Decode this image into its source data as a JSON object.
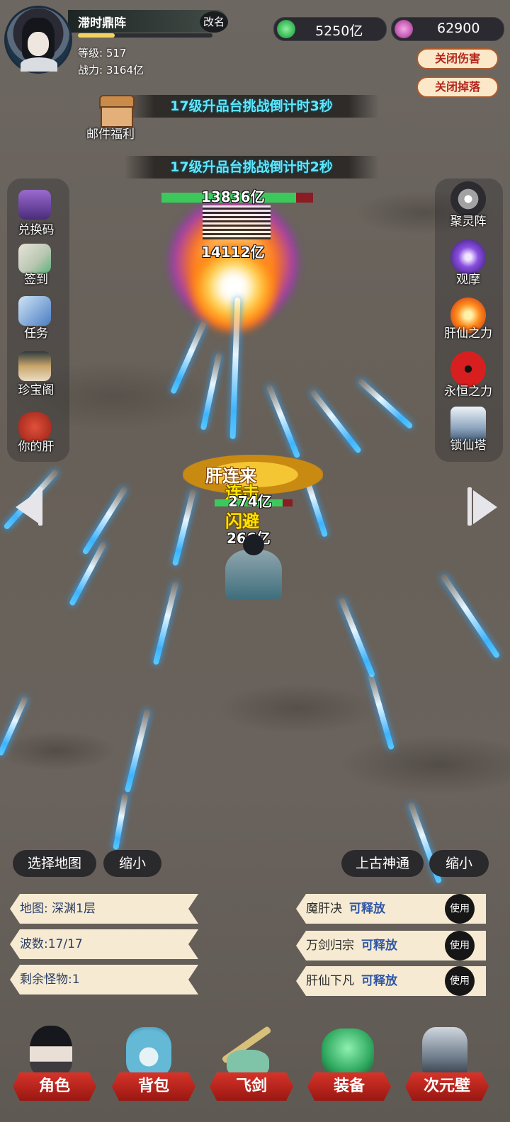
{
  "player": {
    "name": "滞时鼎阵",
    "rename_label": "改名",
    "level_text": "等级: 517",
    "power_text": "战力: 3164亿"
  },
  "currency": [
    {
      "icon": "green-gem-icon",
      "value": "5250亿",
      "color": "#3dbb5a"
    },
    {
      "icon": "pink-orb-icon",
      "value": "62900",
      "color": "#c45bb3"
    }
  ],
  "toggles": {
    "damage_label": "关闭伤害",
    "drop_label": "关闭掉落"
  },
  "banners": [
    "17级升品台挑战倒计时3秒",
    "17级升品台挑战倒计时2秒"
  ],
  "mail": {
    "label": "邮件福利"
  },
  "left_menu": [
    {
      "label": "兑换码",
      "icon": "treasure-chest-icon"
    },
    {
      "label": "签到",
      "icon": "scroll-icon"
    },
    {
      "label": "任务",
      "icon": "task-scroll-icon"
    },
    {
      "label": "珍宝阁",
      "icon": "pavilion-icon"
    },
    {
      "label": "你的肝",
      "icon": "liver-icon"
    }
  ],
  "right_menu": [
    {
      "label": "聚灵阵",
      "icon": "spirit-array-icon"
    },
    {
      "label": "观摩",
      "icon": "purple-orb-icon"
    },
    {
      "label": "肝仙之力",
      "icon": "fire-orb-icon"
    },
    {
      "label": "永恒之力",
      "icon": "red-eye-icon"
    },
    {
      "label": "锁仙塔",
      "icon": "tower-icon"
    }
  ],
  "battle": {
    "boss_damage_top": "13836亿",
    "boss_damage_bottom": "14112亿",
    "hero_title": "肝连来",
    "hero_damage_1": "274亿",
    "hero_damage_2": "266亿",
    "combo_text_1": "连击",
    "combo_text_2": "闪避"
  },
  "controls": {
    "select_map": "选择地图",
    "shrink_left": "缩小",
    "ancient_power": "上古神通",
    "shrink_right": "缩小"
  },
  "stage_info": {
    "map": "地图: 深渊1层",
    "wave": "波数:17/17",
    "remaining": "剩余怪物:1"
  },
  "skills": [
    {
      "name": "魔肝决",
      "status": "可释放",
      "use": "使用"
    },
    {
      "name": "万剑归宗",
      "status": "可释放",
      "use": "使用"
    },
    {
      "name": "肝仙下凡",
      "status": "可释放",
      "use": "使用"
    }
  ],
  "bottom_nav": [
    {
      "label": "角色",
      "icon": "character-icon"
    },
    {
      "label": "背包",
      "icon": "bag-icon"
    },
    {
      "label": "飞剑",
      "icon": "flying-sword-icon"
    },
    {
      "label": "装备",
      "icon": "dragon-equipment-icon"
    },
    {
      "label": "次元壁",
      "icon": "dimension-wall-icon"
    }
  ]
}
